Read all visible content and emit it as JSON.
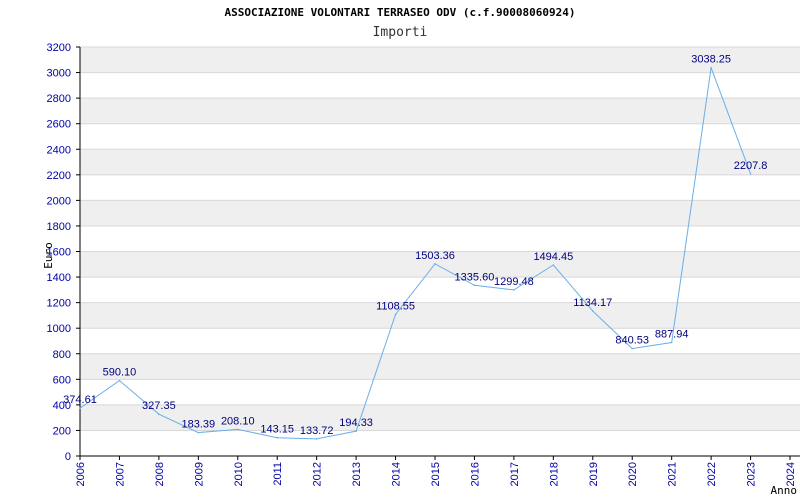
{
  "header": {
    "title": "ASSOCIAZIONE VOLONTARI TERRASEO ODV (c.f.90008060924)",
    "subtitle": "Importi"
  },
  "colors": {
    "line": "#6aaee8",
    "band": "#efefef",
    "grid": "#d8d8d8",
    "tick_text": "#0000aa",
    "label_text": "#000080"
  },
  "chart_data": {
    "type": "line",
    "title": "ASSOCIAZIONE VOLONTARI TERRASEO ODV (c.f.90008060924)",
    "subtitle": "Importi",
    "xlabel": "Anno",
    "ylabel": "Euro",
    "categories": [
      "2006",
      "2007",
      "2008",
      "2009",
      "2010",
      "2011",
      "2012",
      "2013",
      "2014",
      "2015",
      "2016",
      "2017",
      "2018",
      "2019",
      "2020",
      "2021",
      "2022",
      "2023",
      "2024"
    ],
    "series": [
      {
        "values": [
          374.61,
          590.1,
          327.35,
          183.39,
          208.1,
          143.15,
          133.72,
          194.33,
          1108.55,
          1503.36,
          1335.6,
          1299.48,
          1494.45,
          1134.17,
          840.53,
          887.94,
          3038.25,
          2207.8
        ],
        "labels": [
          "374.61",
          "590.10",
          "327.35",
          "183.39",
          "208.10",
          "143.15",
          "133.72",
          "194.33",
          "1108.55",
          "1503.36",
          "1335.60",
          "1299.48",
          "1494.45",
          "1134.17",
          "840.53",
          "887.94",
          "3038.25",
          "2207.8"
        ]
      }
    ],
    "ylim": [
      0,
      3200
    ],
    "yticks": [
      "0",
      "200",
      "400",
      "600",
      "800",
      "1000",
      "1200",
      "1400",
      "1600",
      "1800",
      "2000",
      "2200",
      "2400",
      "2600",
      "2800",
      "3000",
      "3200"
    ],
    "grid": true,
    "legend": "none"
  }
}
